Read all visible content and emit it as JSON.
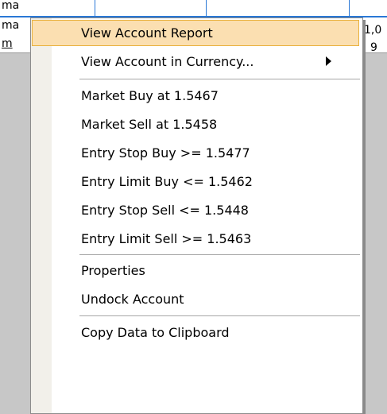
{
  "grid": {
    "r1c1": "ma",
    "r2c1": "ma",
    "r3c1": "m",
    "r2right": "1,0",
    "r3right": "9"
  },
  "menu": {
    "items": [
      {
        "label": "View Account Report"
      },
      {
        "label": "View Account in Currency..."
      },
      {
        "label": "Market Buy at 1.5467"
      },
      {
        "label": "Market Sell at 1.5458"
      },
      {
        "label": "Entry Stop Buy >= 1.5477"
      },
      {
        "label": "Entry Limit Buy <= 1.5462"
      },
      {
        "label": "Entry Stop Sell <= 1.5448"
      },
      {
        "label": "Entry Limit Sell >= 1.5463"
      },
      {
        "label": "Properties"
      },
      {
        "label": "Undock Account"
      },
      {
        "label": "Copy Data to Clipboard"
      }
    ],
    "highlighted_item": "View Account Report"
  }
}
